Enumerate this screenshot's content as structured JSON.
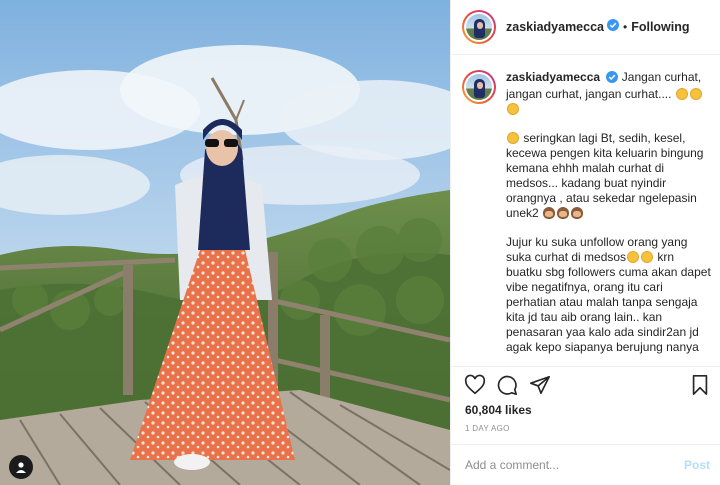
{
  "post": {
    "username": "zaskiadyamecca",
    "follow_label": "Following",
    "separator": "•",
    "caption": {
      "line1": "Jangan curhat, jangan curhat, jangan curhat.... ",
      "para2": " seringkan lagi Bt, sedih, kesel, kecewa pengen kita keluarin bingung kemana ehhh malah curhat di medsos... kadang buat nyindir orangnya , atau sekedar ngelepasin unek2 ",
      "para3a": "Jujur ku suka unfollow orang yang suka curhat di medsos",
      "para3b": " krn buatku sbg followers cuma akan dapet vibe negatifnya, orang itu cari perhatian atau malah tanpa sengaja kita jd tau aib orang lain.. kan penasaran yaa kalo ada sindir2an jd agak kepo siapanya berujung nanya"
    },
    "likes": "60,804 likes",
    "time": "1 DAY AGO",
    "comment_placeholder": "Add a comment...",
    "post_label": "Post"
  },
  "icons": {
    "verified": "verified-badge-icon",
    "like": "heart-icon",
    "comment": "comment-icon",
    "share": "paper-plane-icon",
    "save": "bookmark-icon",
    "tagged": "user-tag-icon"
  },
  "colors": {
    "verified": "#3897f0",
    "post_disabled": "#b2dffc",
    "muted": "#8e8e8e"
  }
}
